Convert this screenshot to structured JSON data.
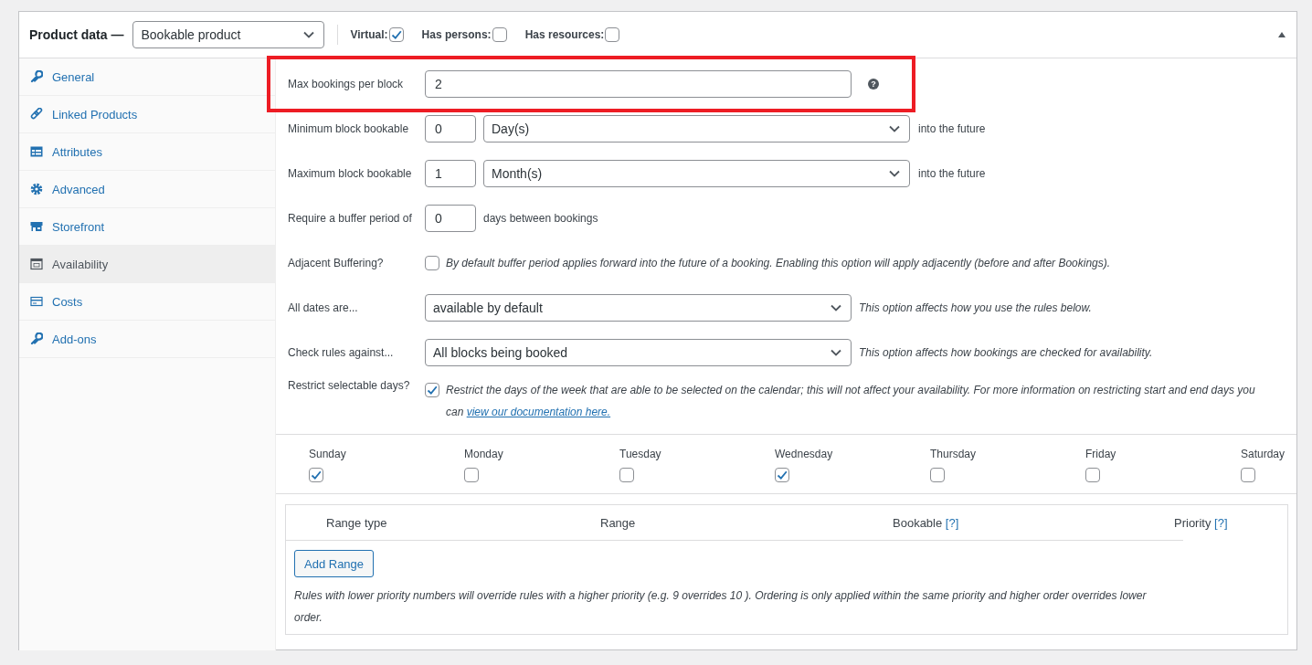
{
  "header": {
    "title": "Product data —",
    "product_type": "Bookable product",
    "options": [
      {
        "label": "Virtual:",
        "checked": true
      },
      {
        "label": "Has persons:",
        "checked": false
      },
      {
        "label": "Has resources:",
        "checked": false
      }
    ]
  },
  "sidebar": {
    "items": [
      {
        "label": "General",
        "selected": false
      },
      {
        "label": "Linked Products",
        "selected": false
      },
      {
        "label": "Attributes",
        "selected": false
      },
      {
        "label": "Advanced",
        "selected": false
      },
      {
        "label": "Storefront",
        "selected": false
      },
      {
        "label": "Availability",
        "selected": true
      },
      {
        "label": "Costs",
        "selected": false
      },
      {
        "label": "Add-ons",
        "selected": false
      }
    ]
  },
  "fields": [
    {
      "kind": "text",
      "label": "Max bookings per block",
      "value": "2",
      "help": "?",
      "highlighted": true
    },
    {
      "kind": "number-select",
      "label": "Minimum block bookable",
      "value": "0",
      "unit": "Day(s)",
      "suffix": "into the future"
    },
    {
      "kind": "number-select",
      "label": "Maximum block bookable",
      "value": "1",
      "unit": "Month(s)",
      "suffix": "into the future"
    },
    {
      "kind": "number",
      "label": "Require a buffer period of",
      "value": "0",
      "suffix": "days between bookings"
    },
    {
      "kind": "checkbox",
      "label": "Adjacent Buffering?",
      "checked": false,
      "description": "By default buffer period applies forward into the future of a booking. Enabling this option will apply adjacently (before and after Bookings)."
    },
    {
      "kind": "select",
      "label": "All dates are...",
      "value": "available by default",
      "description": "This option affects how you use the rules below."
    },
    {
      "kind": "select",
      "label": "Check rules against...",
      "value": "All blocks being booked",
      "description": "This option affects how bookings are checked for availability."
    },
    {
      "kind": "checkbox",
      "label": "Restrict selectable days?",
      "checked": true,
      "description": "Restrict the days of the week that are able to be selected on the calendar; this will not affect your availability. For more information on restricting start and end days you can ",
      "link": "view our documentation here."
    }
  ],
  "days": [
    {
      "label": "Sunday",
      "checked": true
    },
    {
      "label": "Monday",
      "checked": false
    },
    {
      "label": "Tuesday",
      "checked": false
    },
    {
      "label": "Wednesday",
      "checked": true
    },
    {
      "label": "Thursday",
      "checked": false
    },
    {
      "label": "Friday",
      "checked": false
    },
    {
      "label": "Saturday",
      "checked": false
    }
  ],
  "ranges": {
    "columns": [
      {
        "label": "Range type"
      },
      {
        "label": "Range"
      },
      {
        "label": "Bookable",
        "help": "[?]"
      },
      {
        "label": "Priority",
        "help": "[?]"
      }
    ],
    "add_button": "Add Range",
    "note": "Rules with lower priority numbers will override rules with a higher priority (e.g. 9 overrides 10 ). Ordering is only applied within the same priority and higher order overrides lower order."
  }
}
